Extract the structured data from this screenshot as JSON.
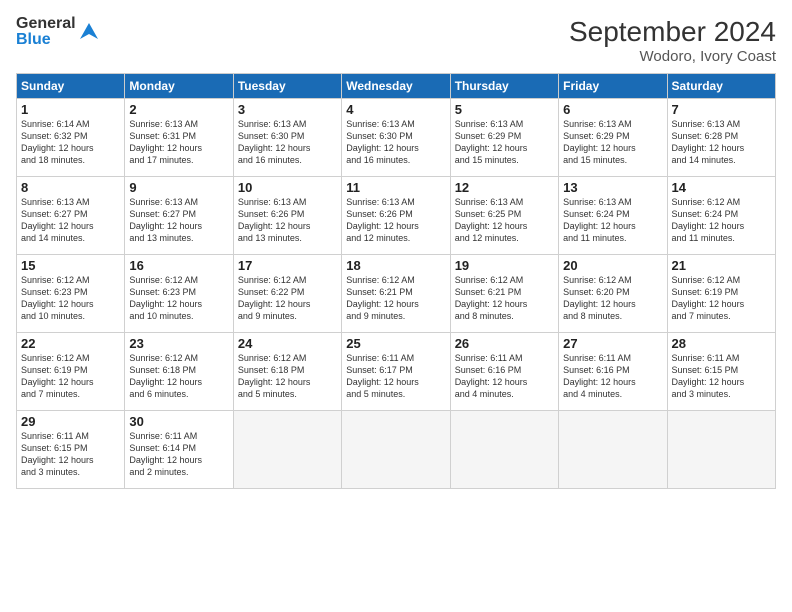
{
  "header": {
    "logo_general": "General",
    "logo_blue": "Blue",
    "month_title": "September 2024",
    "location": "Wodoro, Ivory Coast"
  },
  "days_of_week": [
    "Sunday",
    "Monday",
    "Tuesday",
    "Wednesday",
    "Thursday",
    "Friday",
    "Saturday"
  ],
  "weeks": [
    [
      {
        "day": "1",
        "info": "Sunrise: 6:14 AM\nSunset: 6:32 PM\nDaylight: 12 hours\nand 18 minutes."
      },
      {
        "day": "2",
        "info": "Sunrise: 6:13 AM\nSunset: 6:31 PM\nDaylight: 12 hours\nand 17 minutes."
      },
      {
        "day": "3",
        "info": "Sunrise: 6:13 AM\nSunset: 6:30 PM\nDaylight: 12 hours\nand 16 minutes."
      },
      {
        "day": "4",
        "info": "Sunrise: 6:13 AM\nSunset: 6:30 PM\nDaylight: 12 hours\nand 16 minutes."
      },
      {
        "day": "5",
        "info": "Sunrise: 6:13 AM\nSunset: 6:29 PM\nDaylight: 12 hours\nand 15 minutes."
      },
      {
        "day": "6",
        "info": "Sunrise: 6:13 AM\nSunset: 6:29 PM\nDaylight: 12 hours\nand 15 minutes."
      },
      {
        "day": "7",
        "info": "Sunrise: 6:13 AM\nSunset: 6:28 PM\nDaylight: 12 hours\nand 14 minutes."
      }
    ],
    [
      {
        "day": "8",
        "info": "Sunrise: 6:13 AM\nSunset: 6:27 PM\nDaylight: 12 hours\nand 14 minutes."
      },
      {
        "day": "9",
        "info": "Sunrise: 6:13 AM\nSunset: 6:27 PM\nDaylight: 12 hours\nand 13 minutes."
      },
      {
        "day": "10",
        "info": "Sunrise: 6:13 AM\nSunset: 6:26 PM\nDaylight: 12 hours\nand 13 minutes."
      },
      {
        "day": "11",
        "info": "Sunrise: 6:13 AM\nSunset: 6:26 PM\nDaylight: 12 hours\nand 12 minutes."
      },
      {
        "day": "12",
        "info": "Sunrise: 6:13 AM\nSunset: 6:25 PM\nDaylight: 12 hours\nand 12 minutes."
      },
      {
        "day": "13",
        "info": "Sunrise: 6:13 AM\nSunset: 6:24 PM\nDaylight: 12 hours\nand 11 minutes."
      },
      {
        "day": "14",
        "info": "Sunrise: 6:12 AM\nSunset: 6:24 PM\nDaylight: 12 hours\nand 11 minutes."
      }
    ],
    [
      {
        "day": "15",
        "info": "Sunrise: 6:12 AM\nSunset: 6:23 PM\nDaylight: 12 hours\nand 10 minutes."
      },
      {
        "day": "16",
        "info": "Sunrise: 6:12 AM\nSunset: 6:23 PM\nDaylight: 12 hours\nand 10 minutes."
      },
      {
        "day": "17",
        "info": "Sunrise: 6:12 AM\nSunset: 6:22 PM\nDaylight: 12 hours\nand 9 minutes."
      },
      {
        "day": "18",
        "info": "Sunrise: 6:12 AM\nSunset: 6:21 PM\nDaylight: 12 hours\nand 9 minutes."
      },
      {
        "day": "19",
        "info": "Sunrise: 6:12 AM\nSunset: 6:21 PM\nDaylight: 12 hours\nand 8 minutes."
      },
      {
        "day": "20",
        "info": "Sunrise: 6:12 AM\nSunset: 6:20 PM\nDaylight: 12 hours\nand 8 minutes."
      },
      {
        "day": "21",
        "info": "Sunrise: 6:12 AM\nSunset: 6:19 PM\nDaylight: 12 hours\nand 7 minutes."
      }
    ],
    [
      {
        "day": "22",
        "info": "Sunrise: 6:12 AM\nSunset: 6:19 PM\nDaylight: 12 hours\nand 7 minutes."
      },
      {
        "day": "23",
        "info": "Sunrise: 6:12 AM\nSunset: 6:18 PM\nDaylight: 12 hours\nand 6 minutes."
      },
      {
        "day": "24",
        "info": "Sunrise: 6:12 AM\nSunset: 6:18 PM\nDaylight: 12 hours\nand 5 minutes."
      },
      {
        "day": "25",
        "info": "Sunrise: 6:11 AM\nSunset: 6:17 PM\nDaylight: 12 hours\nand 5 minutes."
      },
      {
        "day": "26",
        "info": "Sunrise: 6:11 AM\nSunset: 6:16 PM\nDaylight: 12 hours\nand 4 minutes."
      },
      {
        "day": "27",
        "info": "Sunrise: 6:11 AM\nSunset: 6:16 PM\nDaylight: 12 hours\nand 4 minutes."
      },
      {
        "day": "28",
        "info": "Sunrise: 6:11 AM\nSunset: 6:15 PM\nDaylight: 12 hours\nand 3 minutes."
      }
    ],
    [
      {
        "day": "29",
        "info": "Sunrise: 6:11 AM\nSunset: 6:15 PM\nDaylight: 12 hours\nand 3 minutes."
      },
      {
        "day": "30",
        "info": "Sunrise: 6:11 AM\nSunset: 6:14 PM\nDaylight: 12 hours\nand 2 minutes."
      },
      {
        "day": "",
        "info": ""
      },
      {
        "day": "",
        "info": ""
      },
      {
        "day": "",
        "info": ""
      },
      {
        "day": "",
        "info": ""
      },
      {
        "day": "",
        "info": ""
      }
    ]
  ]
}
